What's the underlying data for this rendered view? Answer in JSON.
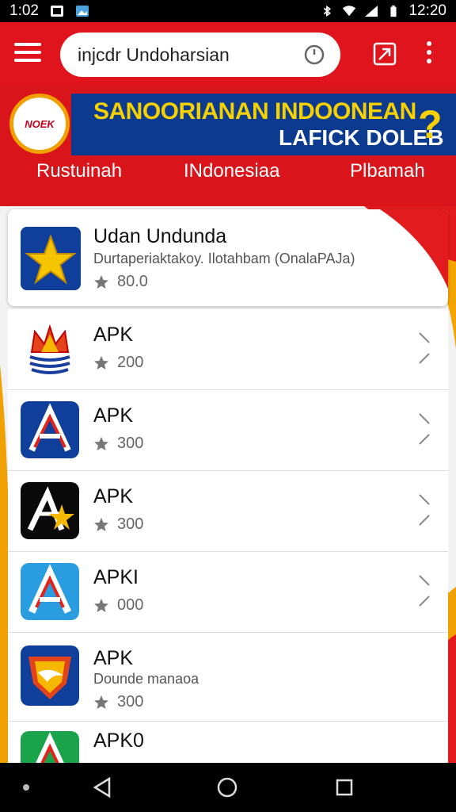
{
  "status_bar": {
    "time": "1:02",
    "clock": "12:20"
  },
  "search": {
    "value": "injcdr Undoharsian"
  },
  "banner": {
    "logo_text": "NOEK",
    "title": "SANOORIANAN INDOONEAN",
    "subtitle": "LAFICK DOLEB",
    "tabs": [
      "Rustuinah",
      "INdonesiaa",
      "Plbamah"
    ]
  },
  "featured": {
    "title": "Udan Undunda",
    "description": "Durtaperiaktakoy. Ilotahbam (OnalaPAJa)",
    "rating": "80.0"
  },
  "apps": [
    {
      "name": "APK",
      "rating": "200",
      "icon": "crown-flag-icon"
    },
    {
      "name": "APK",
      "rating": "300",
      "icon": "letter-a-icon"
    },
    {
      "name": "APK",
      "rating": "300",
      "icon": "star-a-icon"
    },
    {
      "name": "APKI",
      "rating": "000",
      "icon": "letter-a-blue-icon"
    },
    {
      "name": "APK",
      "subtitle": "Dounde manaoa",
      "rating": "300",
      "icon": "shield-bird-icon"
    },
    {
      "name": "APK0",
      "icon": "letter-a-green-icon"
    }
  ],
  "colors": {
    "primary": "#e0141c",
    "banner_blue": "#0b3a8f",
    "accent": "#f6d000"
  }
}
